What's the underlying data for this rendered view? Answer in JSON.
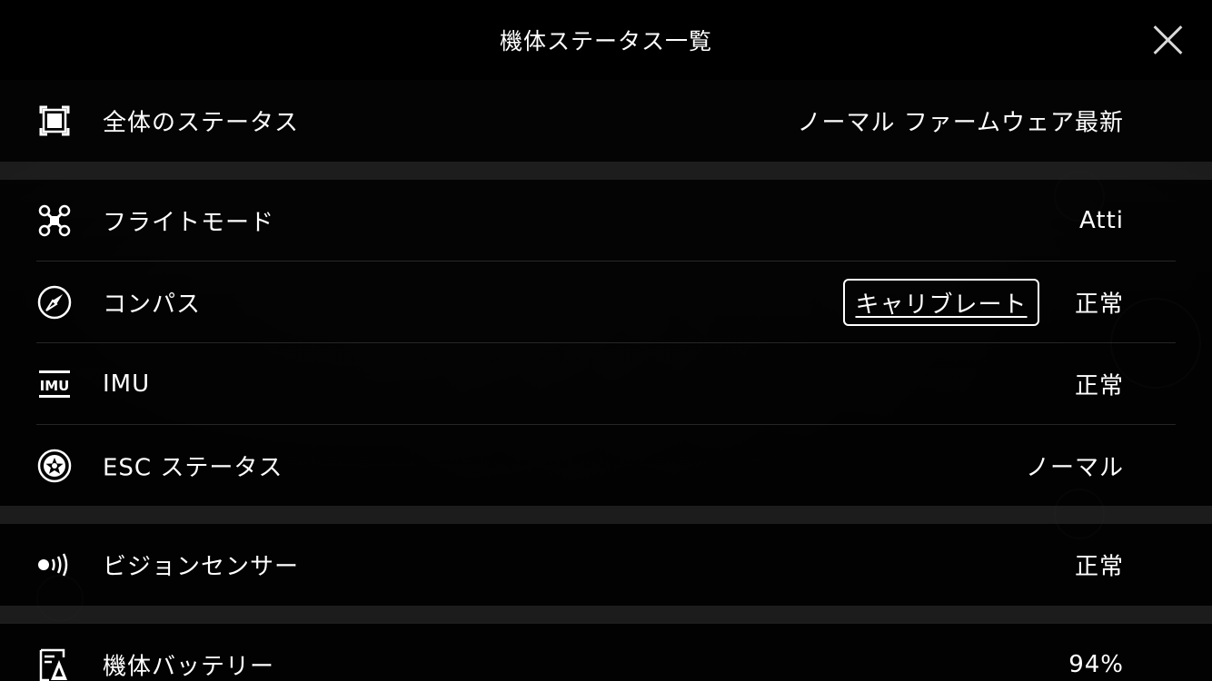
{
  "header": {
    "title": "機体ステータス一覧"
  },
  "rows": {
    "overall": {
      "label": "全体のステータス",
      "value": "ノーマル ファームウェア最新",
      "icon": "overall-status-icon"
    },
    "flight_mode": {
      "label": "フライトモード",
      "value": "Atti",
      "icon": "drone-icon"
    },
    "compass": {
      "label": "コンパス",
      "value": "正常",
      "button": "キャリブレート",
      "icon": "compass-icon"
    },
    "imu": {
      "label": "IMU",
      "value": "正常",
      "icon": "imu-icon"
    },
    "esc": {
      "label": "ESC ステータス",
      "value": "ノーマル",
      "icon": "esc-icon"
    },
    "vision": {
      "label": "ビジョンセンサー",
      "value": "正常",
      "icon": "vision-sensor-icon"
    },
    "battery": {
      "label": "機体バッテリー",
      "value": "94%",
      "icon": "battery-icon"
    }
  }
}
